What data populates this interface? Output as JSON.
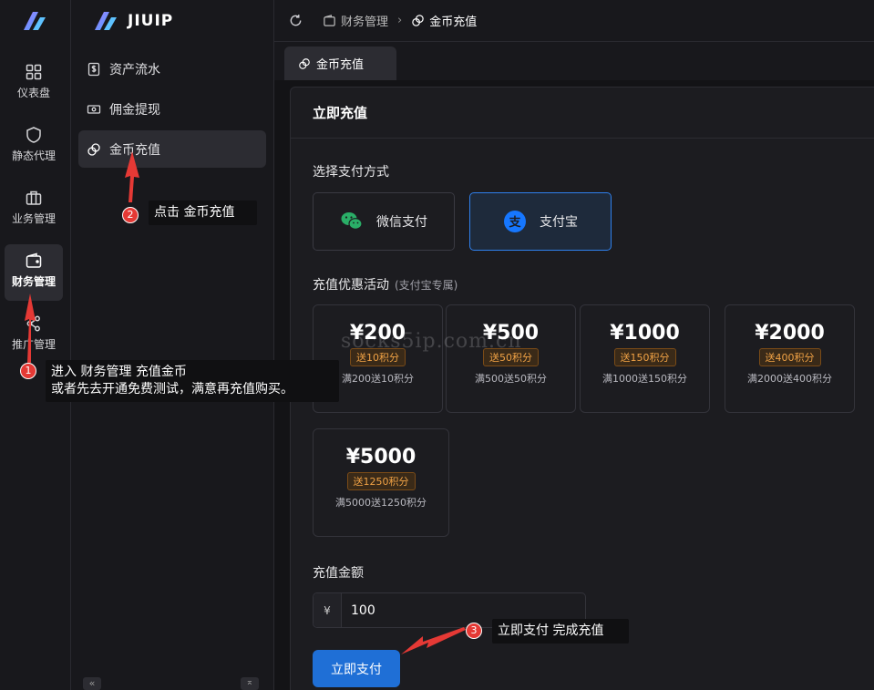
{
  "brand": {
    "name": "JIUIP"
  },
  "rail": {
    "items": [
      {
        "label": "仪表盘",
        "icon": "grid-icon"
      },
      {
        "label": "静态代理",
        "icon": "shield-icon"
      },
      {
        "label": "业务管理",
        "icon": "briefcase-icon"
      },
      {
        "label": "财务管理",
        "icon": "wallet-icon",
        "active": true
      },
      {
        "label": "推广管理",
        "icon": "share-icon"
      }
    ]
  },
  "sidebar": {
    "items": [
      {
        "label": "资产流水",
        "icon": "dollar-doc-icon"
      },
      {
        "label": "佣金提现",
        "icon": "cash-icon"
      },
      {
        "label": "金币充值",
        "icon": "coins-icon",
        "active": true
      }
    ],
    "collapse_glyph": "«",
    "pin_glyph": "⌅"
  },
  "header": {
    "breadcrumb": [
      "财务管理",
      "金币充值"
    ],
    "separator": "›"
  },
  "tabs": [
    {
      "label": "金币充值"
    }
  ],
  "main": {
    "title": "立即充值",
    "pay_method_label": "选择支付方式",
    "pay_methods": [
      {
        "label": "微信支付",
        "icon": "wechat-icon",
        "selected": false
      },
      {
        "label": "支付宝",
        "icon": "alipay-icon",
        "selected": true
      }
    ],
    "promo_label": "充值优惠活动",
    "promo_note": "(支付宝专属)",
    "amounts": [
      {
        "price": "¥200",
        "bonus": "送10积分",
        "desc": "满200送10积分"
      },
      {
        "price": "¥500",
        "bonus": "送50积分",
        "desc": "满500送50积分"
      },
      {
        "price": "¥1000",
        "bonus": "送150积分",
        "desc": "满1000送150积分"
      },
      {
        "price": "¥2000",
        "bonus": "送400积分",
        "desc": "满2000送400积分"
      },
      {
        "price": "¥5000",
        "bonus": "送1250积分",
        "desc": "满5000送1250积分"
      }
    ],
    "amount_label": "充值金额",
    "currency_prefix": "¥",
    "amount_value": "100",
    "submit_label": "立即支付"
  },
  "annotations": [
    {
      "num": "1",
      "line1": "进入 财务管理  充值金币",
      "line2": "或者先去开通免费测试，满意再充值购买。"
    },
    {
      "num": "2",
      "text": "点击 金币充值"
    },
    {
      "num": "3",
      "text": "立即支付 完成充值"
    }
  ],
  "watermark": "socks5ip.com.cn",
  "colors": {
    "accent": "#1f6fd6",
    "annotation_red": "#e53935",
    "bonus_orange": "#f0a245"
  }
}
